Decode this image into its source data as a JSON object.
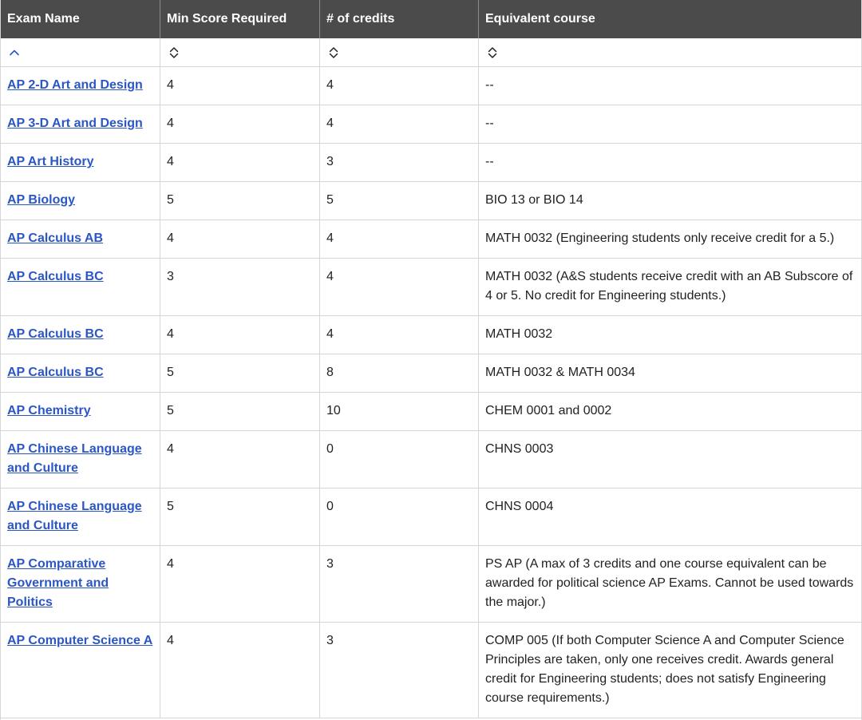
{
  "header": {
    "col1": "Exam Name",
    "col2": "Min Score Required",
    "col3": "# of credits",
    "col4": "Equivalent course"
  },
  "sort_icons": {
    "col1": "sort-ascending-icon",
    "col2": "sort-unsorted-icon",
    "col3": "sort-unsorted-icon",
    "col4": "sort-unsorted-icon"
  },
  "colors": {
    "header_bg": "#4b4b4b",
    "header_text": "#ffffff",
    "link": "#2a56c6",
    "border": "#d6d6d6"
  },
  "rows": [
    {
      "exam": "AP 2-D Art and Design",
      "score": "4",
      "credits": "4",
      "equiv": "--"
    },
    {
      "exam": "AP 3-D Art and Design",
      "score": "4",
      "credits": "4",
      "equiv": "--"
    },
    {
      "exam": "AP Art History",
      "score": "4",
      "credits": "3",
      "equiv": "--"
    },
    {
      "exam": "AP Biology",
      "score": "5",
      "credits": "5",
      "equiv": "BIO 13 or BIO 14"
    },
    {
      "exam": "AP Calculus AB",
      "score": "4",
      "credits": "4",
      "equiv": "MATH 0032 (Engineering students only receive credit for a 5.)"
    },
    {
      "exam": "AP Calculus BC",
      "score": "3",
      "credits": "4",
      "equiv": "MATH 0032 (A&S students receive credit with an AB Subscore of 4 or 5. No credit for Engineering students.)"
    },
    {
      "exam": "AP Calculus BC",
      "score": "4",
      "credits": "4",
      "equiv": "MATH 0032"
    },
    {
      "exam": "AP Calculus BC",
      "score": "5",
      "credits": "8",
      "equiv": "MATH 0032 & MATH 0034"
    },
    {
      "exam": "AP Chemistry",
      "score": "5",
      "credits": "10",
      "equiv": "CHEM 0001 and 0002"
    },
    {
      "exam": "AP Chinese Language and Culture",
      "score": "4",
      "credits": "0",
      "equiv": "CHNS 0003"
    },
    {
      "exam": "AP Chinese Language and Culture",
      "score": "5",
      "credits": "0",
      "equiv": "CHNS 0004"
    },
    {
      "exam": "AP Comparative Government and Politics",
      "score": "4",
      "credits": "3",
      "equiv": "PS AP (A max of 3 credits and one course equivalent can be awarded for political science AP Exams. Cannot be used towards the major.)"
    },
    {
      "exam": "AP Computer Science A",
      "score": "4",
      "credits": "3",
      "equiv": "COMP 005 (If both Computer Science A and Computer Science Principles are taken, only one receives credit. Awards general credit for Engineering students; does not satisfy Engineering course requirements.)"
    }
  ]
}
